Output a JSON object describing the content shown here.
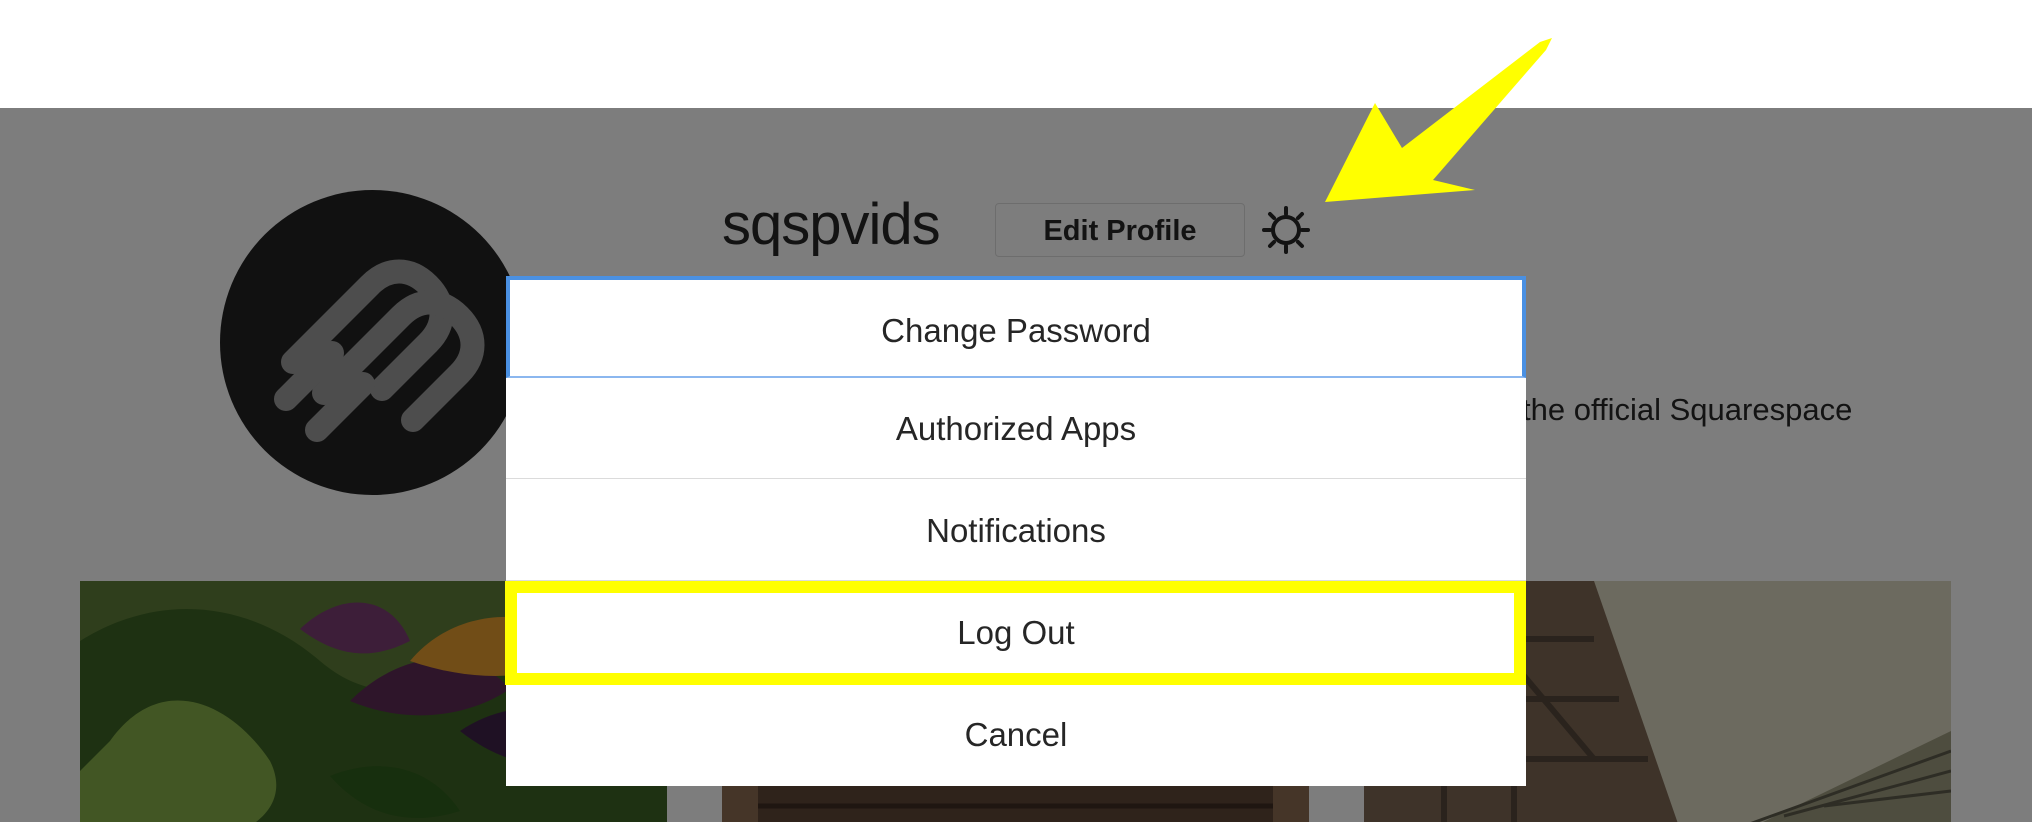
{
  "profile": {
    "username": "sqspvids",
    "edit_profile_label": "Edit Profile",
    "bio_text": "the official Squarespace"
  },
  "menu": {
    "items": [
      {
        "label": "Change Password"
      },
      {
        "label": "Authorized Apps"
      },
      {
        "label": "Notifications"
      },
      {
        "label": "Log Out"
      },
      {
        "label": "Cancel"
      }
    ]
  },
  "icons": {
    "avatar_logo": "squarespace-logo",
    "settings": "gear-icon",
    "annotation": "arrow-icon"
  },
  "colors": {
    "overlay": "#808080",
    "menu_background": "#ffffff",
    "focus_outline": "#4a90e2",
    "highlight": "#ffff00",
    "text": "#262626"
  }
}
